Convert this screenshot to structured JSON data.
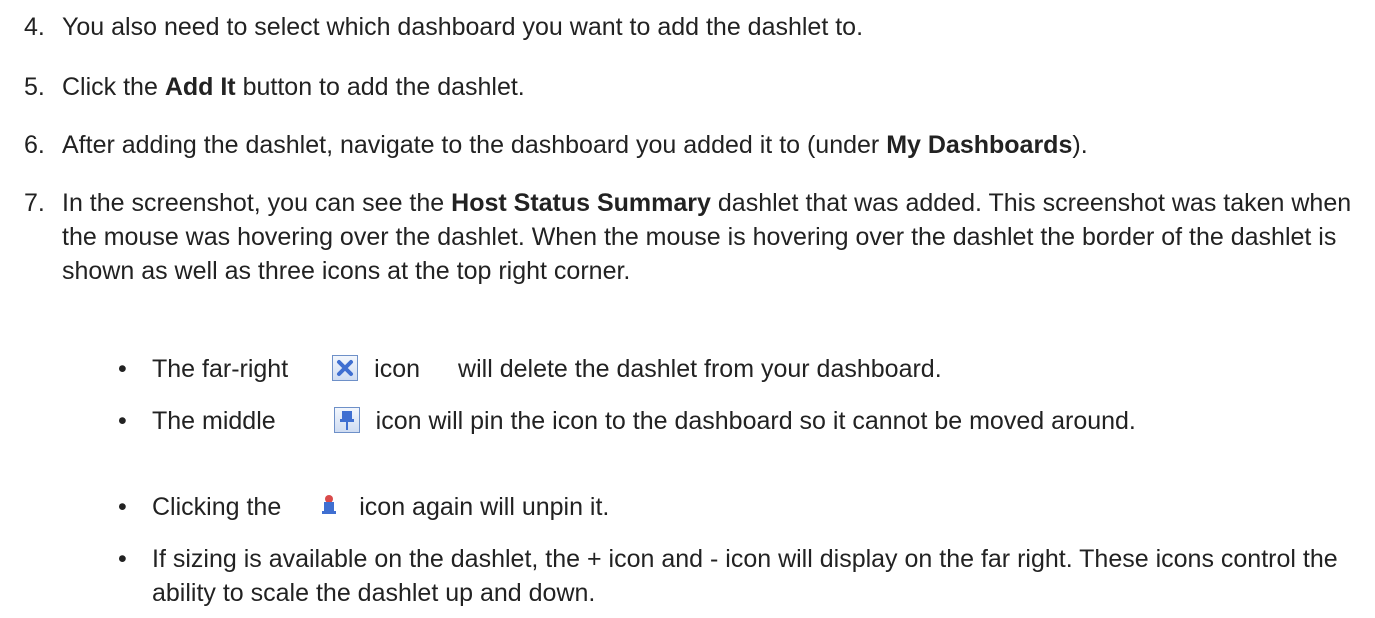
{
  "steps": [
    {
      "num": "4.",
      "text": "You also need to select which dashboard you want to add the dashlet to."
    },
    {
      "num": "5.",
      "pre": "Click the ",
      "bold": "Add It",
      "post": " button to add the dashlet."
    },
    {
      "num": "6.",
      "pre": "After adding the dashlet, navigate to the dashboard you added it to (under ",
      "bold": "My Dashboards",
      "post": ")."
    },
    {
      "num": "7.",
      "pre": "In the screenshot, you can see the ",
      "bold": "Host Status Summary",
      "post": " dashlet that was added.  This screenshot was taken when the mouse was hovering over the dashlet.  When the mouse is hovering over the dashlet the border of the dashlet is shown as well as three icons at the top right corner."
    }
  ],
  "bullets": {
    "marker": "•",
    "b1": {
      "pre": "The far-right",
      "icon": "close-x-icon",
      "post1": "icon",
      "post2": "will delete the dashlet from your dashboard."
    },
    "b2": {
      "pre": "The middle",
      "icon": "pin-icon",
      "post": "icon will pin the icon to the dashboard so it cannot be moved around."
    },
    "b3": {
      "pre": "Clicking the",
      "icon": "pinned-icon",
      "post": "icon again will unpin it."
    },
    "b4": {
      "text": "If sizing is available on the dashlet, the + icon and - icon will display on the far right. These icons control the ability to scale the dashlet up and down."
    }
  },
  "colors": {
    "text": "#222222",
    "icon_border": "#6e90c8",
    "icon_blue": "#3f6fd1"
  }
}
